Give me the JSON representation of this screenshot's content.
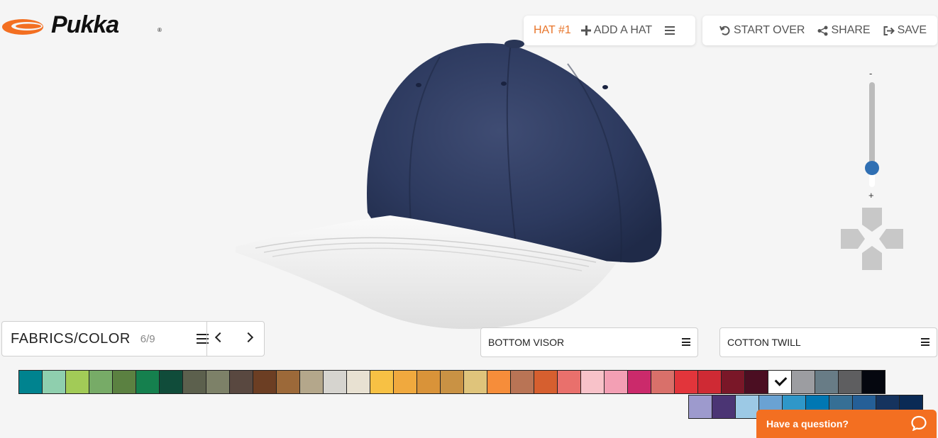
{
  "brand": {
    "name": "Pukka",
    "registered": "®",
    "accent_color": "#f36f21"
  },
  "header": {
    "current_hat": "HAT #1",
    "add_hat": "ADD A HAT",
    "start_over": "START OVER",
    "share": "SHARE",
    "save": "SAVE"
  },
  "zoom": {
    "minus": "-",
    "plus": "+",
    "level": 0.82,
    "thumb_color": "#2f6fb3"
  },
  "section": {
    "title": "FABRICS/COLOR",
    "position": "6/9"
  },
  "part_select": {
    "value": "BOTTOM VISOR"
  },
  "fabric_select": {
    "value": "COTTON TWILL"
  },
  "swatches_row1": [
    "#00838f",
    "#8fcfae",
    "#a2cb57",
    "#77ab67",
    "#5b8141",
    "#15804e",
    "#104c3a",
    "#5c604d",
    "#7d8168",
    "#594840",
    "#6c3e23",
    "#9c6939",
    "#b4a78b",
    "#d6d4cf",
    "#e8e1d2",
    "#f7c144",
    "#f0a93e",
    "#d99339",
    "#c99244",
    "#dfc47b",
    "#f68d3a",
    "#b97455",
    "#d65f2f",
    "#e9706c",
    "#f8c2c9",
    "#f39fb4",
    "#cb2a6b",
    "#d9706a",
    "#e2353b",
    "#cf2a34",
    "#7a1728",
    "#4b0e22",
    "#ffffff",
    "#9c9da1",
    "#687c86",
    "#5e5e60",
    "#05070f"
  ],
  "selected_swatch_index": 32,
  "swatches_row2": [
    "#9d9acd",
    "#4b3574",
    "#9cc9e5",
    "#6aa2d3",
    "#2f97c9",
    "#0077b3",
    "#366f95",
    "#255f97",
    "#15335e",
    "#0a2a55"
  ],
  "chat": {
    "label": "Have a question?"
  }
}
